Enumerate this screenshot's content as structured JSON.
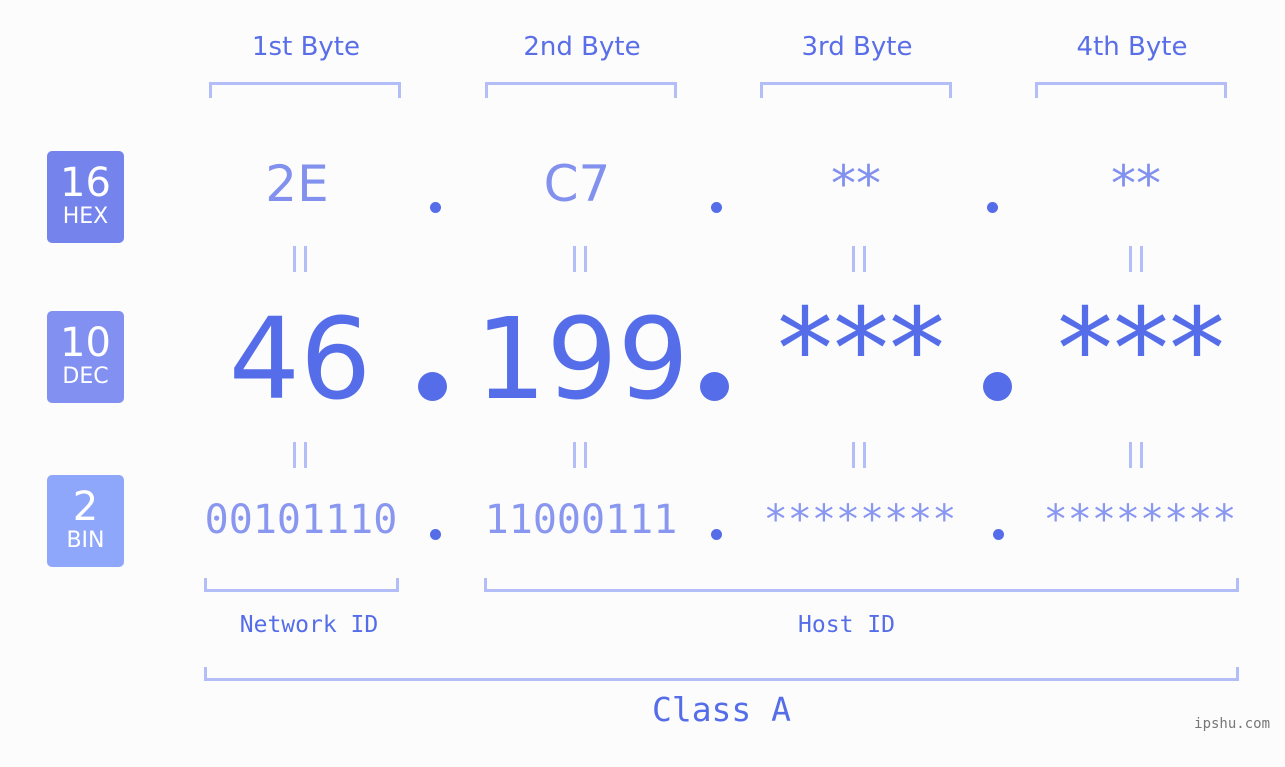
{
  "byte_headers": [
    "1st Byte",
    "2nd Byte",
    "3rd Byte",
    "4th Byte"
  ],
  "badges": {
    "hex": {
      "number": "16",
      "label": "HEX",
      "color": "#7583ec"
    },
    "dec": {
      "number": "10",
      "label": "DEC",
      "color": "#8291f1"
    },
    "bin": {
      "number": "2",
      "label": "BIN",
      "color": "#8fa7fb"
    }
  },
  "hex": [
    "2E",
    "C7",
    "**",
    "**"
  ],
  "dec": [
    "46",
    "199",
    "***",
    "***"
  ],
  "bin": [
    "00101110",
    "11000111",
    "********",
    "********"
  ],
  "equals_symbol": "=",
  "network_id_label": "Network ID",
  "host_id_label": "Host ID",
  "class_label": "Class A",
  "watermark": "ipshu.com",
  "colors": {
    "primary": "#566de9",
    "bracket": "#b3bdf7",
    "hex_text": "#8391ee",
    "bin_text": "#8997f0"
  }
}
